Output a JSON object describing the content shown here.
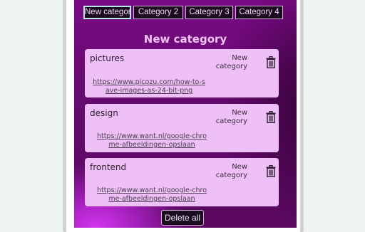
{
  "tabs": [
    {
      "label": "New category",
      "active": true
    },
    {
      "label": "Category 2",
      "active": false
    },
    {
      "label": "Category 3",
      "active": false
    },
    {
      "label": "Category 4",
      "active": false
    }
  ],
  "heading": "New category",
  "cards": [
    {
      "title": "pictures",
      "category": "New category",
      "link": "https://www.picozu.com/how-to-save-images-as-24-bit-png"
    },
    {
      "title": "design",
      "category": "New category",
      "link": "https://www.want.nl/google-chrome-afbeeldingen-opslaan"
    },
    {
      "title": "frontend",
      "category": "New category",
      "link": "https://www.want.nl/google-chrome-afbeeldingen-opslaan"
    }
  ],
  "delete_all_label": "Delete all",
  "icons": {
    "trash": "trash-icon"
  },
  "colors": {
    "card_bg": "#efbff8",
    "heading": "#f1c6f6",
    "tab_bg": "#1a0a1e",
    "accent_border": "#b9ecec"
  }
}
